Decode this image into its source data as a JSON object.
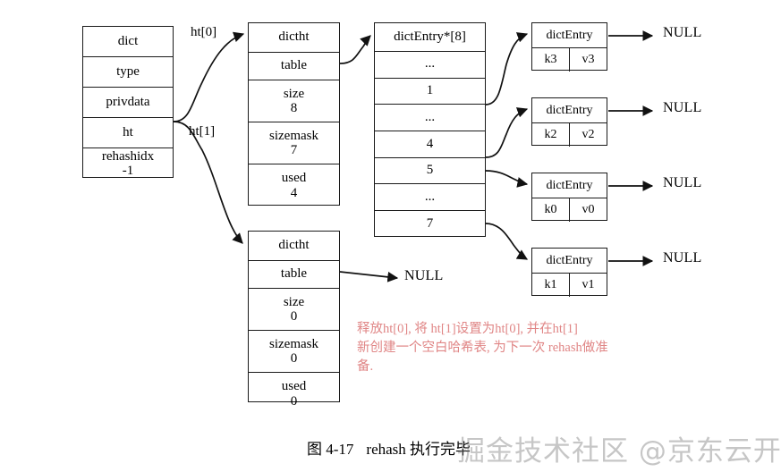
{
  "figure": {
    "caption_prefix": "图 4-17",
    "caption_text": "rehash 执行完毕",
    "watermark": "掘金技术社区 @京东云开发者"
  },
  "dict": {
    "title": "dict",
    "fields": [
      {
        "name": "type",
        "value": ""
      },
      {
        "name": "privdata",
        "value": ""
      },
      {
        "name": "ht",
        "value": ""
      },
      {
        "name": "rehashidx",
        "value": "-1"
      }
    ]
  },
  "pointers": {
    "ht0_label": "ht[0]",
    "ht1_label": "ht[1]"
  },
  "hashtables": [
    {
      "title": "dictht",
      "table_label": "table",
      "size_label": "size",
      "size_value": "8",
      "sizemask_label": "sizemask",
      "sizemask_value": "7",
      "used_label": "used",
      "used_value": "4"
    },
    {
      "title": "dictht",
      "table_label": "table",
      "size_label": "size",
      "size_value": "0",
      "sizemask_label": "sizemask",
      "sizemask_value": "0",
      "used_label": "used",
      "used_value": "0",
      "table_target": "NULL"
    }
  ],
  "bucket_table": {
    "title": "dictEntry*[8]",
    "slots": [
      "...",
      "1",
      "...",
      "4",
      "5",
      "...",
      "7"
    ]
  },
  "entries": [
    {
      "title": "dictEntry",
      "key": "k3",
      "value": "v3",
      "next": "NULL"
    },
    {
      "title": "dictEntry",
      "key": "k2",
      "value": "v2",
      "next": "NULL"
    },
    {
      "title": "dictEntry",
      "key": "k0",
      "value": "v0",
      "next": "NULL"
    },
    {
      "title": "dictEntry",
      "key": "k1",
      "value": "v1",
      "next": "NULL"
    }
  ],
  "annotation": {
    "color": "#e08686",
    "line1": "释放ht[0], 将 ht[1]设置为ht[0], 并在ht[1]",
    "line2": "新创建一个空白哈希表, 为下一次 rehash做准",
    "line3": "备."
  }
}
